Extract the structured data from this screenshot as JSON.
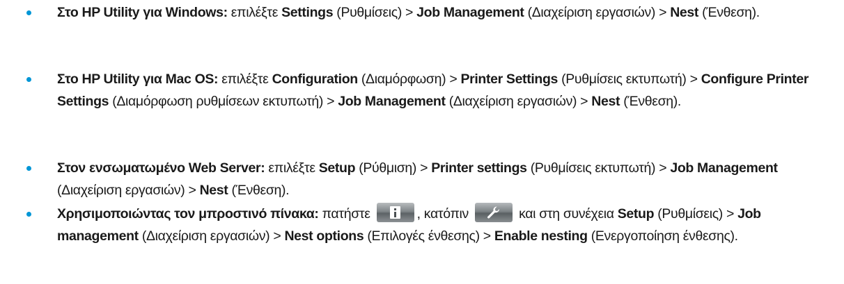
{
  "items": [
    {
      "lead": "Στο HP Utility για Windows:",
      "t1": " επιλέξτε ",
      "b1": "Settings",
      "t2": " (Ρυθμίσεις) > ",
      "b2": "Job Management",
      "t3": " (Διαχείριση εργασιών) > ",
      "b3": "Nest",
      "t4": " (Ένθεση)."
    },
    {
      "lead": "Στο HP Utility για Mac OS:",
      "t1": " επιλέξτε ",
      "b1": "Configuration",
      "t2": " (Διαμόρφωση) > ",
      "b2": "Printer Settings",
      "t3": " (Ρυθμίσεις εκτυπωτή) > ",
      "b3": "Configure Printer Settings",
      "t4": " (Διαμόρφωση ρυθμίσεων εκτυπωτή) > ",
      "b4": "Job Management",
      "t5": " (Διαχείριση εργασιών) > ",
      "b5": "Nest",
      "t6": " (Ένθεση)."
    },
    {
      "lead": "Στον ενσωματωμένο Web Server:",
      "t1": " επιλέξτε ",
      "b1": "Setup",
      "t2": " (Ρύθμιση) > ",
      "b2": "Printer settings",
      "t3": " (Ρυθμίσεις εκτυπωτή) > ",
      "b3": "Job Management",
      "t4": " (Διαχείριση εργασιών) > ",
      "b4": "Nest",
      "t5": " (Ένθεση)."
    },
    {
      "lead": "Χρησιμοποιώντας τον μπροστινό πίνακα:",
      "t1": " πατήστε ",
      "icon1": "info-icon",
      "t2": ", κατόπιν ",
      "icon2": "wrench-icon",
      "t3": " και στη συνέχεια ",
      "b1": "Setup",
      "t4": " (Ρυθμίσεις) > ",
      "b2": "Job management",
      "t5": " (Διαχείριση εργασιών) > ",
      "b3": "Nest options",
      "t6": " (Επιλογές ένθεσης) > ",
      "b4": "Enable nesting",
      "t7": " (Ενεργοποίηση ένθεσης)."
    }
  ],
  "colors": {
    "bullet": "#0096d6",
    "text": "#1a1a1a"
  }
}
